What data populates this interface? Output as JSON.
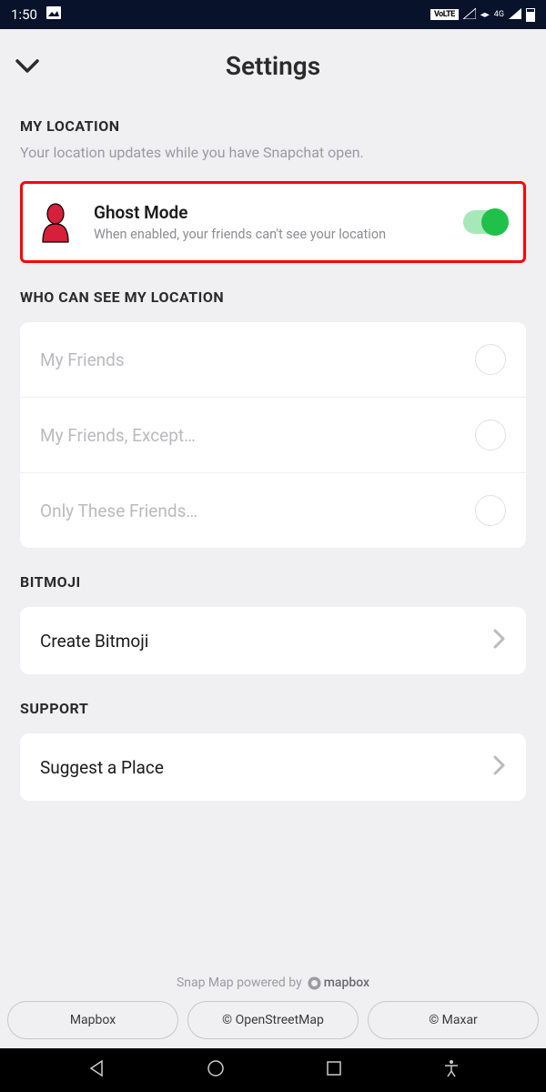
{
  "status_bar": {
    "time": "1:50",
    "volte": "VoLTE",
    "network": "4G"
  },
  "header": {
    "title": "Settings"
  },
  "my_location": {
    "header": "MY LOCATION",
    "subtitle": "Your location updates while you have Snapchat open.",
    "ghost_mode": {
      "title": "Ghost Mode",
      "description": "When enabled, your friends can't see your location",
      "enabled": true
    }
  },
  "who_can_see": {
    "header": "WHO CAN SEE MY LOCATION",
    "options": [
      {
        "label": "My Friends"
      },
      {
        "label": "My Friends, Except…"
      },
      {
        "label": "Only These Friends…"
      }
    ]
  },
  "bitmoji": {
    "header": "BITMOJI",
    "item": "Create Bitmoji"
  },
  "support": {
    "header": "SUPPORT",
    "item": "Suggest a Place"
  },
  "footer": {
    "powered_text": "Snap Map powered by",
    "provider": "mapbox",
    "buttons": [
      "Mapbox",
      "© OpenStreetMap",
      "© Maxar"
    ]
  }
}
